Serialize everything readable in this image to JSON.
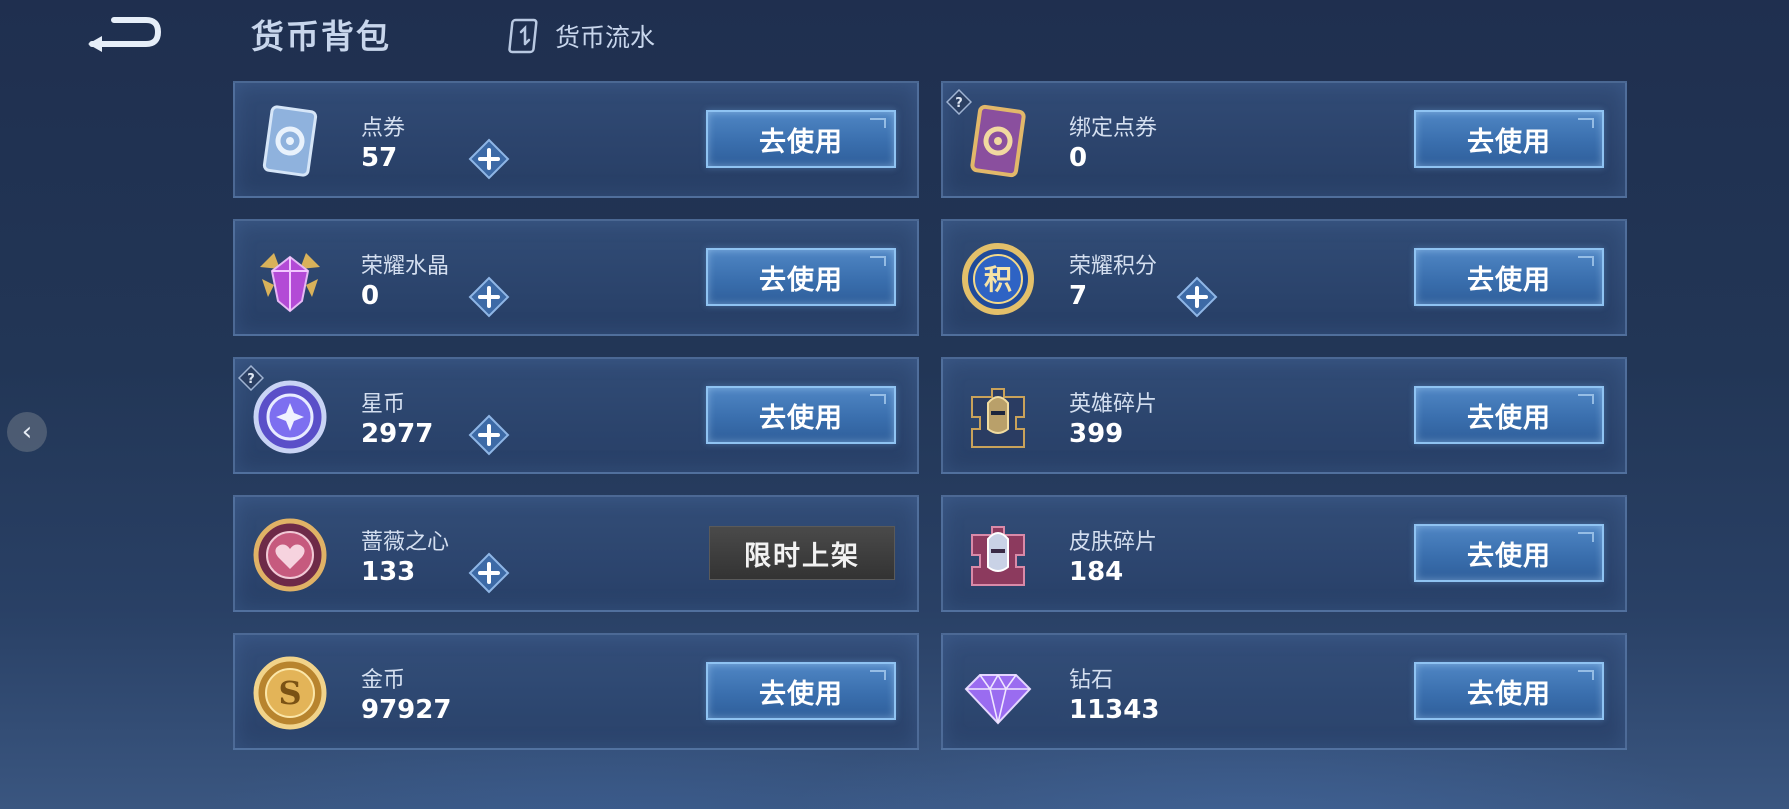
{
  "header": {
    "title": "货币背包",
    "flow_label": "货币流水"
  },
  "side_nav": {
    "arrow_glyph": "‹"
  },
  "currencies": [
    {
      "id": "ticket",
      "name": "点券",
      "amount": "57",
      "icon": "ticket-card-icon",
      "has_plus": true,
      "has_help": false,
      "action": "去使用",
      "action_type": "use"
    },
    {
      "id": "bound-ticket",
      "name": "绑定点券",
      "amount": "0",
      "icon": "bound-ticket-card-icon",
      "has_plus": false,
      "has_help": true,
      "action": "去使用",
      "action_type": "use"
    },
    {
      "id": "glory-crystal",
      "name": "荣耀水晶",
      "amount": "0",
      "icon": "glory-crystal-icon",
      "has_plus": true,
      "has_help": false,
      "action": "去使用",
      "action_type": "use"
    },
    {
      "id": "glory-points",
      "name": "荣耀积分",
      "amount": "7",
      "icon": "glory-points-icon",
      "has_plus": true,
      "has_help": false,
      "action": "去使用",
      "action_type": "use"
    },
    {
      "id": "star-coin",
      "name": "星币",
      "amount": "2977",
      "icon": "star-coin-icon",
      "has_plus": true,
      "has_help": true,
      "action": "去使用",
      "action_type": "use"
    },
    {
      "id": "hero-shard",
      "name": "英雄碎片",
      "amount": "399",
      "icon": "hero-shard-icon",
      "has_plus": false,
      "has_help": false,
      "action": "去使用",
      "action_type": "use"
    },
    {
      "id": "rose-heart",
      "name": "蔷薇之心",
      "amount": "133",
      "icon": "rose-heart-icon",
      "has_plus": true,
      "has_help": false,
      "action": "限时上架",
      "action_type": "limited"
    },
    {
      "id": "skin-shard",
      "name": "皮肤碎片",
      "amount": "184",
      "icon": "skin-shard-icon",
      "has_plus": false,
      "has_help": false,
      "action": "去使用",
      "action_type": "use"
    },
    {
      "id": "gold-coin",
      "name": "金币",
      "amount": "97927",
      "icon": "gold-coin-icon",
      "has_plus": false,
      "has_help": false,
      "action": "去使用",
      "action_type": "use"
    },
    {
      "id": "diamond",
      "name": "钻石",
      "amount": "11343",
      "icon": "diamond-icon",
      "has_plus": false,
      "has_help": false,
      "action": "去使用",
      "action_type": "use"
    }
  ]
}
